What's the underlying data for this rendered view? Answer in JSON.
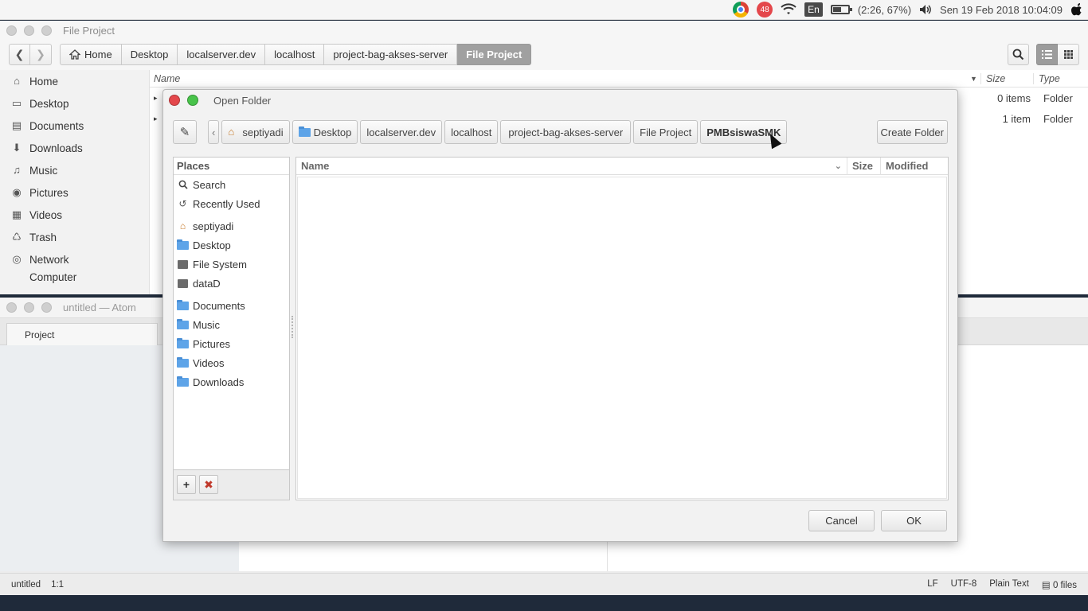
{
  "topbar": {
    "notification_count": "48",
    "lang": "En",
    "battery": "(2:26, 67%)",
    "clock": "Sen 19 Feb 2018 10:04:09"
  },
  "file_manager": {
    "title": "File Project",
    "breadcrumbs": [
      "Home",
      "Desktop",
      "localserver.dev",
      "localhost",
      "project-bag-akses-server",
      "File Project"
    ],
    "sidebar": [
      {
        "label": "Home",
        "icon": "home-icon"
      },
      {
        "label": "Desktop",
        "icon": "desktop-icon"
      },
      {
        "label": "Documents",
        "icon": "documents-icon"
      },
      {
        "label": "Downloads",
        "icon": "downloads-icon"
      },
      {
        "label": "Music",
        "icon": "music-icon"
      },
      {
        "label": "Pictures",
        "icon": "pictures-icon"
      },
      {
        "label": "Videos",
        "icon": "videos-icon"
      },
      {
        "label": "Trash",
        "icon": "trash-icon"
      },
      {
        "label": "Network",
        "icon": "network-icon"
      },
      {
        "label": "Computer",
        "icon": "computer-icon"
      }
    ],
    "columns": {
      "name": "Name",
      "size": "Size",
      "type": "Type"
    },
    "rows": [
      {
        "size": "0 items",
        "type": "Folder"
      },
      {
        "size": "1 item",
        "type": "Folder"
      }
    ]
  },
  "atom": {
    "title": "untitled — Atom",
    "tab": "Project",
    "status": {
      "file": "untitled",
      "cursor": "1:1",
      "line_ending": "LF",
      "encoding": "UTF-8",
      "grammar": "Plain Text",
      "files": "0 files"
    }
  },
  "dialog": {
    "title": "Open Folder",
    "path": [
      "septiyadi",
      "Desktop",
      "localserver.dev",
      "localhost",
      "project-bag-akses-server",
      "File Project",
      "PMBsiswaSMK"
    ],
    "create_folder": "Create Folder",
    "places_header": "Places",
    "places": [
      {
        "label": "Search",
        "icon": "search-icon"
      },
      {
        "label": "Recently Used",
        "icon": "recent-icon"
      },
      {
        "label": "septiyadi",
        "icon": "home-icon"
      },
      {
        "label": "Desktop",
        "icon": "folder-icon"
      },
      {
        "label": "File System",
        "icon": "drive-icon"
      },
      {
        "label": "dataD",
        "icon": "drive-icon"
      },
      {
        "label": "Documents",
        "icon": "folder-icon"
      },
      {
        "label": "Music",
        "icon": "folder-icon"
      },
      {
        "label": "Pictures",
        "icon": "folder-icon"
      },
      {
        "label": "Videos",
        "icon": "folder-icon"
      },
      {
        "label": "Downloads",
        "icon": "folder-icon"
      }
    ],
    "columns": {
      "name": "Name",
      "size": "Size",
      "modified": "Modified"
    },
    "cancel": "Cancel",
    "ok": "OK"
  },
  "colors": {
    "close_red": "#e4474b",
    "maximize_green": "#48c34a",
    "folder_blue": "#5ea4e8"
  }
}
